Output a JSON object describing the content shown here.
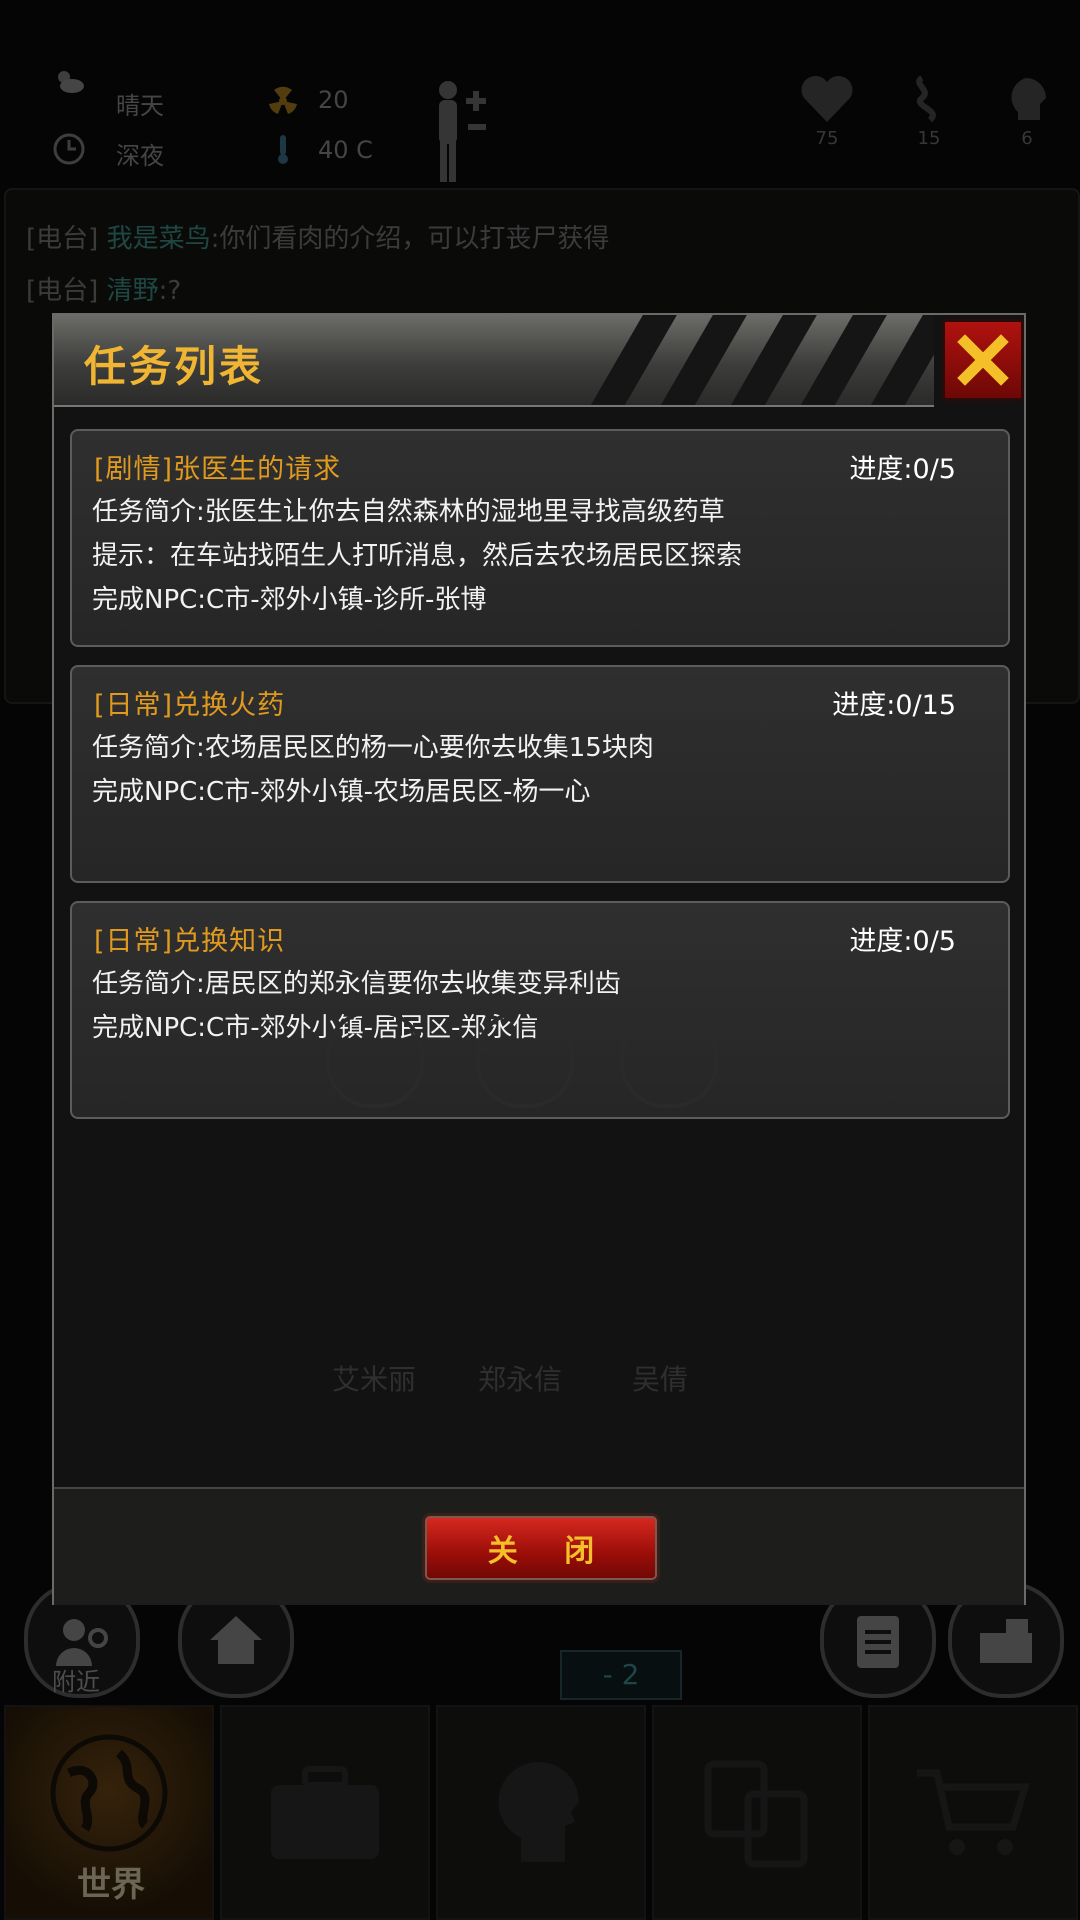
{
  "status": {
    "weather": "晴天",
    "time_of_day": "深夜",
    "radiation": "20",
    "temperature": "40 C",
    "health": "75",
    "hunger": "15",
    "sanity": "6"
  },
  "chat": [
    {
      "channel": "[电台]",
      "sender": "我是菜鸟",
      "message": ":你们看肉的介绍，可以打丧尸获得"
    },
    {
      "channel": "[电台]",
      "sender": "清野",
      "message": ":?"
    }
  ],
  "modal": {
    "title": "任务列表",
    "close_label": "关 闭",
    "tasks": [
      {
        "title": "[剧情]张医生的请求",
        "progress": "进度:0/5",
        "lines": [
          "任务简介:张医生让你去自然森林的湿地里寻找高级药草",
          "提示：在车站找陌生人打听消息，然后去农场居民区探索",
          "完成NPC:C市-郊外小镇-诊所-张博"
        ]
      },
      {
        "title": "[日常]兑换火药",
        "progress": "进度:0/15",
        "lines": [
          "任务简介:农场居民区的杨一心要你去收集15块肉",
          "完成NPC:C市-郊外小镇-农场居民区-杨一心"
        ]
      },
      {
        "title": "[日常]兑换知识",
        "progress": "进度:0/5",
        "lines": [
          "任务简介:居民区的郑永信要你去收集变异利齿",
          "完成NPC:C市-郊外小镇-居民区-郑永信"
        ]
      }
    ]
  },
  "npcs": [
    "艾米丽",
    "郑永信",
    "吴倩"
  ],
  "nearby_label": "附近",
  "radar_count": "- 2",
  "nav": {
    "world_label": "世界"
  },
  "colors": {
    "accent": "#f0b532",
    "task_title": "#e09a1f",
    "close_red": "#b0120f"
  }
}
